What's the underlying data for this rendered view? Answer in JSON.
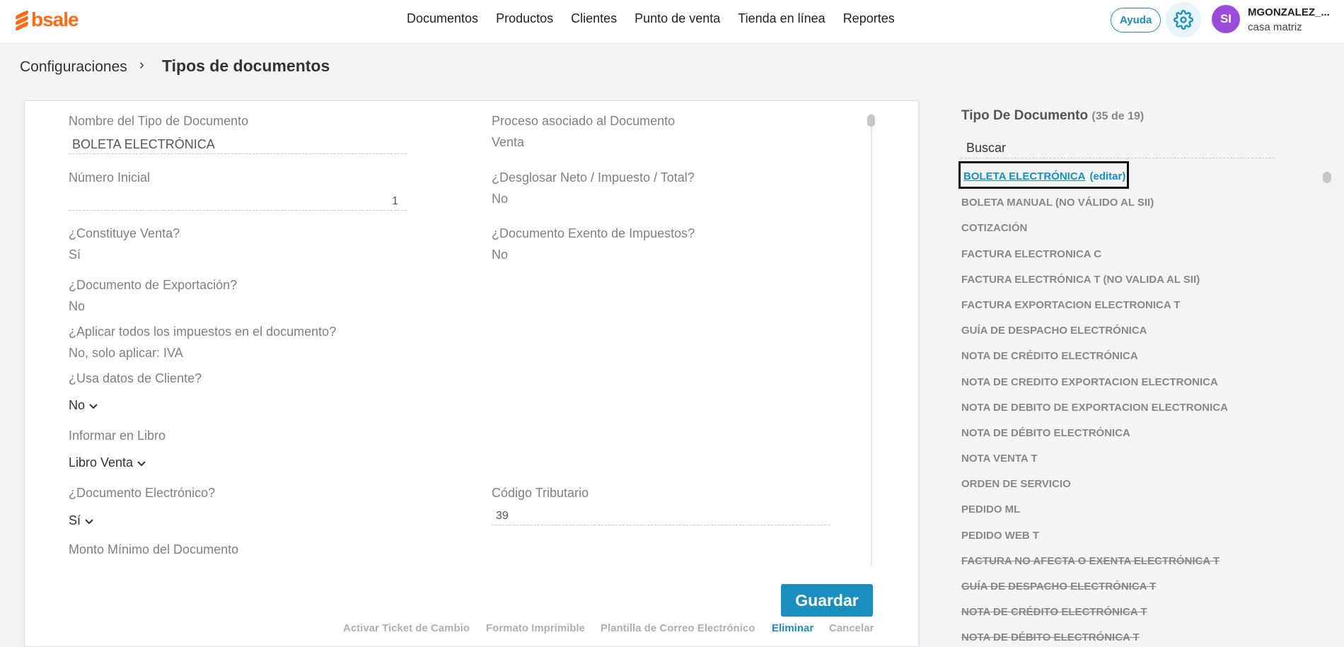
{
  "brand": {
    "logo_text": "bsale",
    "accent": "#ff6a13",
    "primary": "#1a8fbf"
  },
  "nav": {
    "items": [
      "Documentos",
      "Productos",
      "Clientes",
      "Punto de venta",
      "Tienda en línea",
      "Reportes"
    ]
  },
  "header": {
    "help_label": "Ayuda",
    "settings_icon": "gear-icon",
    "avatar_initials": "SI",
    "user_name": "MGONZALEZ_...",
    "branch": "casa matriz"
  },
  "breadcrumb": {
    "root": "Configuraciones",
    "separator": "›",
    "current": "Tipos de documentos"
  },
  "form": {
    "name_label": "Nombre del Tipo de Documento",
    "name_value": "BOLETA ELECTRÓNICA",
    "process_label": "Proceso asociado al Documento",
    "process_value": "Venta",
    "initial_number_label": "Número Inicial",
    "initial_number_value": "1",
    "breakdown_label": "¿Desglosar Neto / Impuesto / Total?",
    "breakdown_value": "No",
    "is_sale_label": "¿Constituye Venta?",
    "is_sale_value": "Sí",
    "tax_exempt_label": "¿Documento Exento de Impuestos?",
    "tax_exempt_value": "No",
    "export_label": "¿Documento de Exportación?",
    "export_value": "No",
    "apply_taxes_label": "¿Aplicar todos los impuestos en el documento?",
    "apply_taxes_value": "No, solo aplicar: IVA",
    "client_data_label": "¿Usa datos de Cliente?",
    "client_data_value": "No",
    "book_label": "Informar en Libro",
    "book_value": "Libro Venta",
    "electronic_label": "¿Documento Electrónico?",
    "electronic_value": "Sí",
    "tax_code_label": "Código Tributario",
    "tax_code_value": "39",
    "min_amount_label": "Monto Mínimo del Documento"
  },
  "actions": {
    "save": "Guardar",
    "activate_ticket": "Activar Ticket de Cambio",
    "print_format": "Formato Imprimible",
    "email_template": "Plantilla de Correo Electrónico",
    "delete": "Eliminar",
    "cancel": "Cancelar"
  },
  "sidebar": {
    "title": "Tipo De Documento",
    "count": "(35 de 19)",
    "search_placeholder": "Buscar",
    "selected_label": "BOLETA ELECTRÓNICA",
    "edit_label": "(editar)",
    "items": [
      "BOLETA MANUAL (NO VÁLIDO AL SII)",
      "COTIZACIÓN",
      "FACTURA ELECTRONICA C",
      "FACTURA ELECTRÓNICA T (NO VALIDA AL SII)",
      "FACTURA EXPORTACION ELECTRONICA T",
      "GUÍA DE DESPACHO ELECTRÓNICA",
      "NOTA DE CRÉDITO ELECTRÓNICA",
      "NOTA DE CREDITO EXPORTACION ELECTRONICA",
      "NOTA DE DEBITO DE EXPORTACION ELECTRONICA",
      "NOTA DE DÉBITO ELECTRÓNICA",
      "NOTA VENTA T",
      "ORDEN DE SERVICIO",
      "PEDIDO ML",
      "PEDIDO WEB T"
    ],
    "disabled_items": [
      "FACTURA NO AFECTA O EXENTA ELECTRÓNICA T",
      "GUÍA DE DESPACHO ELECTRÓNICA T",
      "NOTA DE CRÉDITO ELECTRÓNICA T",
      "NOTA DE DÉBITO ELECTRÓNICA T"
    ]
  }
}
